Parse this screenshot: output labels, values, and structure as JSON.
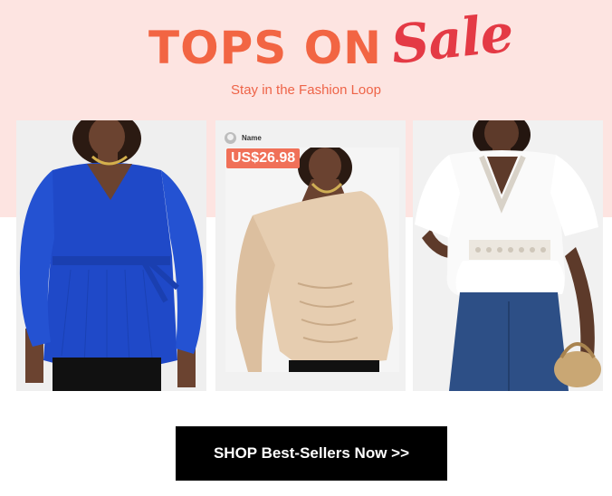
{
  "banner": {
    "headline": "TOPS ON",
    "headline_script": "Sale",
    "subtitle": "Stay in the Fashion Loop"
  },
  "products": [
    {
      "alt": "Blue wrap peplum top with balloon sleeves",
      "color": "#1f49c8"
    },
    {
      "alt": "Champagne satin one-shoulder ruched top",
      "color": "#e6cdb0",
      "poster_name": "Name",
      "price": "US$26.98"
    },
    {
      "alt": "White lace-trim peplum blouse",
      "color": "#fafafa"
    }
  ],
  "cta": {
    "label": "SHOP Best-Sellers Now >>"
  },
  "colors": {
    "accent": "#f26543",
    "script": "#e43a45",
    "hero_bg": "#fde4e1",
    "button": "#000000"
  }
}
